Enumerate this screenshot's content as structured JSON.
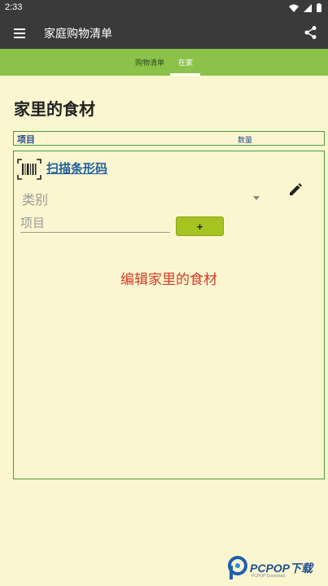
{
  "status_bar": {
    "time": "2:33"
  },
  "app_bar": {
    "title": "家庭购物清单"
  },
  "tabs": [
    {
      "label": "购物清单",
      "selected": false
    },
    {
      "label": "在家",
      "selected": true
    }
  ],
  "page": {
    "heading": "家里的食材",
    "columns": {
      "item": "项目",
      "quantity": "数量"
    }
  },
  "panel": {
    "scan_label": "扫描条形码",
    "category_value": "类别",
    "item_placeholder": "项目",
    "add_label": "+",
    "empty_message": "编辑家里的食材"
  },
  "watermark": {
    "text": "PCPOP下载",
    "sub": "PCPOP Download"
  },
  "colors": {
    "app_bar": "#3a3a3a",
    "tab_bar": "#8bc34a",
    "background": "#fbf6cf",
    "border": "#4a9a3a",
    "accent_button": "#a6c321",
    "empty_text": "#d23c2a",
    "link": "#1e5fa0"
  },
  "icons": [
    "menu-icon",
    "share-icon",
    "wifi-icon",
    "signal-icon",
    "battery-icon",
    "barcode-icon",
    "pencil-icon",
    "chevron-down-icon"
  ]
}
